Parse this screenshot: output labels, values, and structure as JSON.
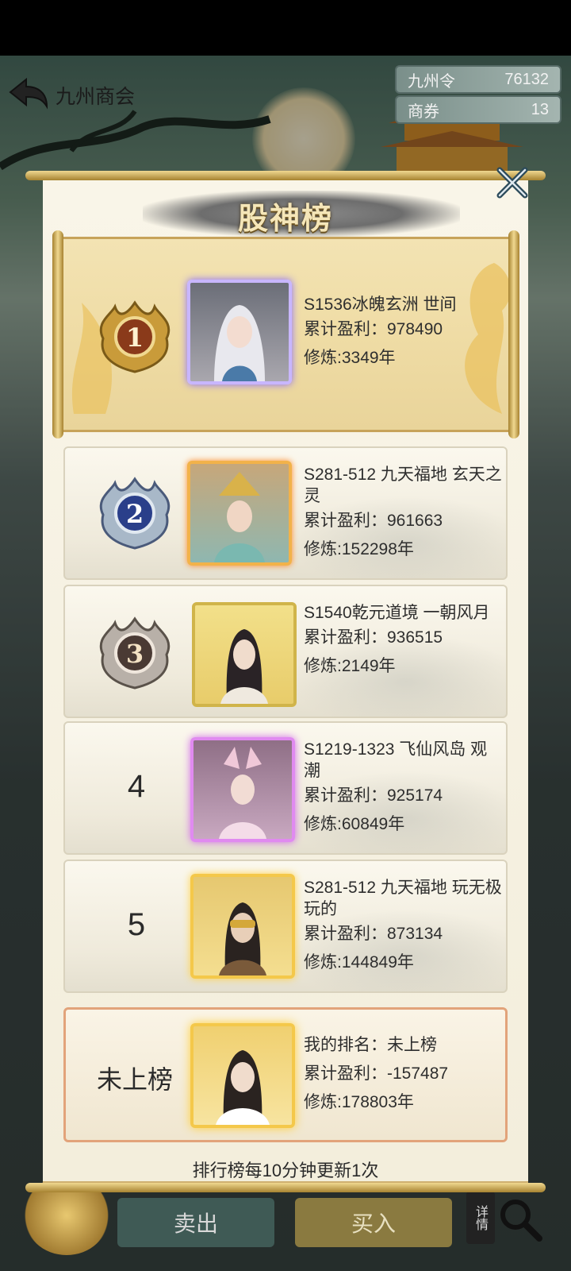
{
  "topbar": {
    "title": "九州商会",
    "currencies": [
      {
        "name": "九州令",
        "value": "76132"
      },
      {
        "name": "商券",
        "value": "13"
      }
    ]
  },
  "bottombar": {
    "sell_label": "卖出",
    "buy_label": "买入",
    "detail_label": "详情"
  },
  "modal": {
    "title": "股神榜",
    "footer_note": "排行榜每10分钟更新1次"
  },
  "ranks": [
    {
      "rank": "1",
      "name": "S1536冰魄玄洲 世间",
      "profit_text": "累计盈利：978490",
      "cultivation_text": "修炼:3349年"
    },
    {
      "rank": "2",
      "name": "S281-512 九天福地 玄天之灵",
      "profit_text": "累计盈利：961663",
      "cultivation_text": "修炼:152298年"
    },
    {
      "rank": "3",
      "name": "S1540乾元道境 一朝风月",
      "profit_text": "累计盈利：936515",
      "cultivation_text": "修炼:2149年"
    },
    {
      "rank": "4",
      "name": "S1219-1323 飞仙风岛 观潮",
      "profit_text": "累计盈利：925174",
      "cultivation_text": "修炼:60849年"
    },
    {
      "rank": "5",
      "name": "S281-512 九天福地 玩无极玩的",
      "profit_text": "累计盈利：873134",
      "cultivation_text": "修炼:144849年"
    }
  ],
  "my_rank": {
    "rank_label": "未上榜",
    "rank_text": "我的排名：未上榜",
    "profit_text": "累计盈利：-157487",
    "cultivation_text": "修炼:178803年"
  },
  "colors": {
    "gold": "#c7a35a",
    "modal_bg": "#f3eedc",
    "my_card_border": "#e2a37a"
  }
}
